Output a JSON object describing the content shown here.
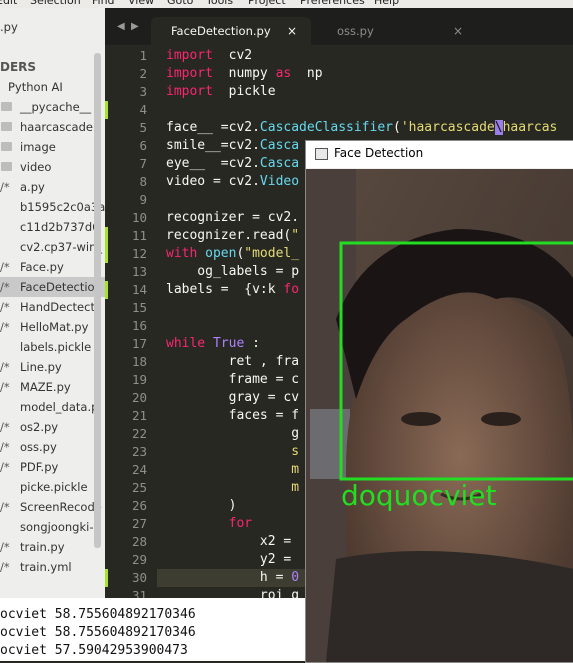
{
  "menubar": [
    "Edit",
    "Selection",
    "Find",
    "View",
    "Goto",
    "Tools",
    "Project",
    "Preferences",
    "Help"
  ],
  "sidebar": {
    "top_file": ".py",
    "header": "DERS",
    "folder": "Python AI",
    "items": [
      {
        "mark": "",
        "icon": "folder",
        "label": "__pycache__"
      },
      {
        "mark": "",
        "icon": "folder",
        "label": "haarcascade"
      },
      {
        "mark": "",
        "icon": "folder",
        "label": "image"
      },
      {
        "mark": "",
        "icon": "folder",
        "label": "video"
      },
      {
        "mark": "/*",
        "icon": "",
        "label": "a.py"
      },
      {
        "mark": "",
        "icon": "",
        "label": "b1595c2c0a3a"
      },
      {
        "mark": "",
        "icon": "",
        "label": "c11d2b737d6"
      },
      {
        "mark": "",
        "icon": "",
        "label": "cv2.cp37-win_"
      },
      {
        "mark": "/*",
        "icon": "",
        "label": "Face.py"
      },
      {
        "mark": "/*",
        "icon": "",
        "label": "FaceDetection"
      },
      {
        "mark": "/*",
        "icon": "",
        "label": "HandDectecti"
      },
      {
        "mark": "/*",
        "icon": "",
        "label": "HelloMat.py"
      },
      {
        "mark": "",
        "icon": "",
        "label": "labels.pickle"
      },
      {
        "mark": "/*",
        "icon": "",
        "label": "Line.py"
      },
      {
        "mark": "/*",
        "icon": "",
        "label": "MAZE.py"
      },
      {
        "mark": "",
        "icon": "",
        "label": "model_data.p"
      },
      {
        "mark": "/*",
        "icon": "",
        "label": "os2.py"
      },
      {
        "mark": "/*",
        "icon": "",
        "label": "oss.py"
      },
      {
        "mark": "/*",
        "icon": "",
        "label": "PDF.py"
      },
      {
        "mark": "",
        "icon": "",
        "label": "picke.pickle"
      },
      {
        "mark": "/*",
        "icon": "",
        "label": "ScreenRecode"
      },
      {
        "mark": "",
        "icon": "",
        "label": "songjoongki-"
      },
      {
        "mark": "/*",
        "icon": "",
        "label": "train.py"
      },
      {
        "mark": "/*",
        "icon": "",
        "label": "train.yml"
      }
    ],
    "selected_index": 9
  },
  "tabs": [
    {
      "label": "FaceDetection.py",
      "close": "×"
    },
    {
      "label": "oss.py",
      "close": "×"
    }
  ],
  "nav_arrows": {
    "left": "◀",
    "right": "▶"
  },
  "code": {
    "modified_lines": [
      4,
      11,
      12,
      14,
      30
    ],
    "current_line": 30,
    "lines": [
      [
        [
          "kw",
          "import"
        ],
        [
          "",
          "  cv2"
        ]
      ],
      [
        [
          "kw",
          "import"
        ],
        [
          "",
          "  numpy "
        ],
        [
          "kw",
          "as"
        ],
        [
          "",
          "  np"
        ]
      ],
      [
        [
          "kw",
          "import"
        ],
        [
          "",
          "  pickle"
        ]
      ],
      [],
      [
        [
          "",
          "face__ =cv2."
        ],
        [
          "cl",
          "CascadeClassifier"
        ],
        [
          "",
          "("
        ],
        [
          "st",
          "'haarcascade"
        ],
        [
          "bs",
          "\\"
        ],
        [
          "st",
          "haarcas"
        ]
      ],
      [
        [
          "",
          "smile__=cv2."
        ],
        [
          "cl",
          "Casca"
        ]
      ],
      [
        [
          "",
          "eye__  =cv2."
        ],
        [
          "cl",
          "Casca"
        ]
      ],
      [
        [
          "",
          "video = cv2."
        ],
        [
          "cl",
          "Video"
        ]
      ],
      [],
      [
        [
          "",
          "recognizer = cv2."
        ]
      ],
      [
        [
          "",
          "recognizer.read("
        ],
        [
          "st",
          "\""
        ]
      ],
      [
        [
          "kw",
          "with"
        ],
        [
          "",
          ""
        ],
        [
          "cl",
          " open"
        ],
        [
          "",
          "("
        ],
        [
          "st",
          "\"model_"
        ]
      ],
      [
        [
          "",
          "    og_labels = p"
        ]
      ],
      [
        [
          "",
          "labels =  {v:k "
        ],
        [
          "kw",
          "fo"
        ]
      ],
      [],
      [],
      [
        [
          "kw",
          "while"
        ],
        [
          "",
          ""
        ],
        [
          "pu",
          " True"
        ],
        [
          "",
          " :"
        ]
      ],
      [
        [
          "",
          "        ret , fra"
        ]
      ],
      [
        [
          "",
          "        frame = c"
        ]
      ],
      [
        [
          "",
          "        gray = cv"
        ]
      ],
      [
        [
          "",
          "        faces = f"
        ]
      ],
      [
        [
          "",
          "                g"
        ]
      ],
      [
        [
          "",
          "                "
        ],
        [
          "st",
          "s"
        ]
      ],
      [
        [
          "",
          "                "
        ],
        [
          "st",
          "m"
        ]
      ],
      [
        [
          "",
          "                "
        ],
        [
          "st",
          "m"
        ]
      ],
      [
        [
          "",
          "        )"
        ]
      ],
      [
        [
          "",
          "        "
        ],
        [
          "kw",
          "for"
        ],
        [
          "",
          "",
          " (x, y"
        ]
      ],
      [
        [
          "",
          "            x2 = "
        ]
      ],
      [
        [
          "",
          "            y2 = "
        ]
      ],
      [
        [
          "",
          "            h = "
        ],
        [
          "pu",
          "0"
        ]
      ],
      [
        [
          "",
          "            roi_g"
        ]
      ]
    ]
  },
  "console": [
    "ocviet 58.755604892170346",
    "ocviet 58.755604892170346",
    "ocviet 57.59042953900473"
  ],
  "cv_window": {
    "title": "Face Detection",
    "label": "doquocviet",
    "box_color": "#22dd22"
  }
}
